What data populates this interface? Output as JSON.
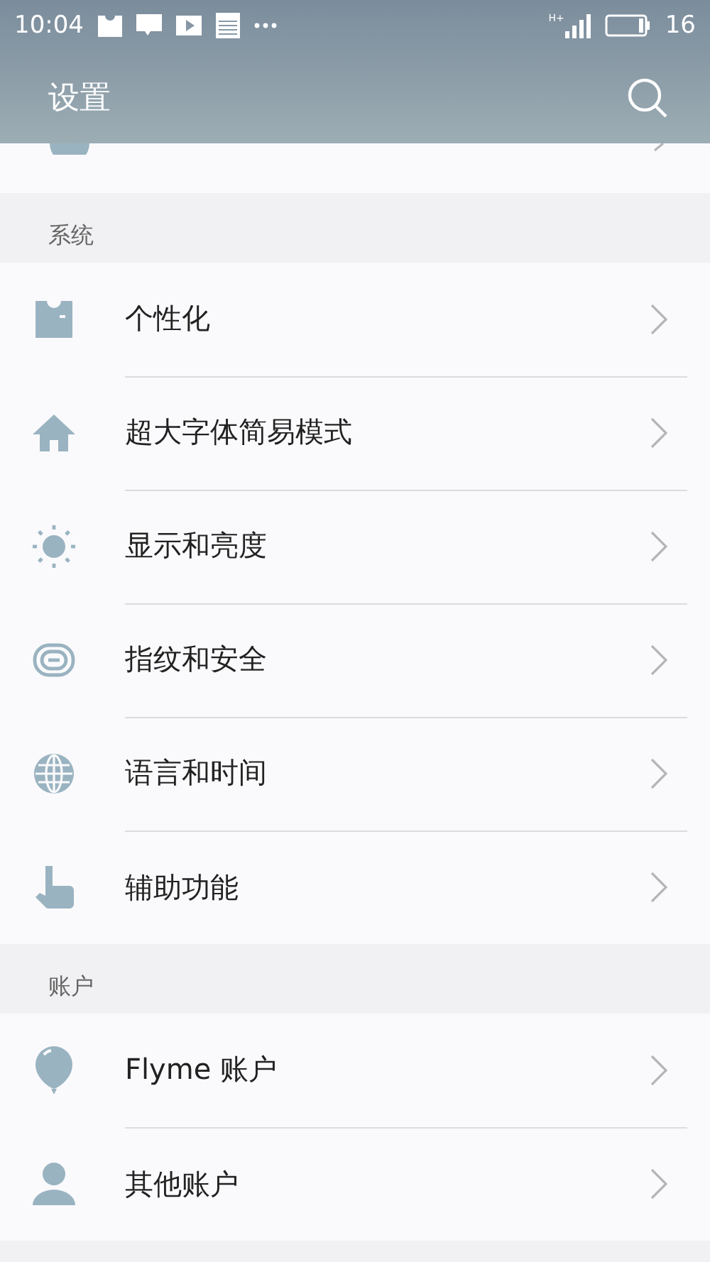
{
  "status_bar": {
    "time": "10:04",
    "network": "H+",
    "battery": "16"
  },
  "header": {
    "title": "设置"
  },
  "sections": [
    {
      "label": "系统",
      "items": [
        {
          "label": "个性化",
          "kind": "shirt"
        },
        {
          "label": "超大字体简易模式",
          "kind": "home"
        },
        {
          "label": "显示和亮度",
          "kind": "sun"
        },
        {
          "label": "指纹和安全",
          "kind": "fingerprint"
        },
        {
          "label": "语言和时间",
          "kind": "globe"
        },
        {
          "label": "辅助功能",
          "kind": "hand"
        }
      ]
    },
    {
      "label": "账户",
      "items": [
        {
          "label": "Flyme 账户",
          "kind": "balloon"
        },
        {
          "label": "其他账户",
          "kind": "person"
        }
      ]
    }
  ]
}
